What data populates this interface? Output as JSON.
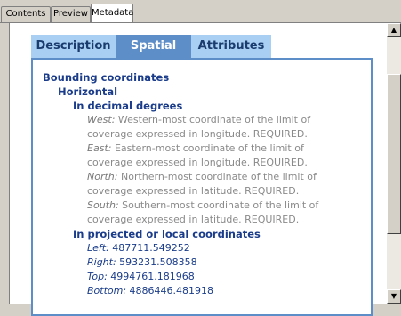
{
  "window_tabs": [
    {
      "label": "Contents",
      "active": false
    },
    {
      "label": "Preview",
      "active": false
    },
    {
      "label": "Metadata",
      "active": true
    }
  ],
  "metadata_tabs": [
    {
      "label": "Description",
      "active": false
    },
    {
      "label": "Spatial",
      "active": true
    },
    {
      "label": "Attributes",
      "active": false
    }
  ],
  "content": {
    "bounding_title": "Bounding coordinates",
    "horizontal": "Horizontal",
    "decimal_title": "In decimal degrees",
    "decimal": [
      {
        "key": "West:",
        "line1": " Western-most coordinate of the limit of",
        "line2": "coverage expressed in longitude. REQUIRED."
      },
      {
        "key": "East:",
        "line1": " Eastern-most coordinate of the limit of",
        "line2": "coverage expressed in longitude. REQUIRED."
      },
      {
        "key": "North:",
        "line1": " Northern-most coordinate of the limit of",
        "line2": "coverage expressed in latitude. REQUIRED."
      },
      {
        "key": "South:",
        "line1": " Southern-most coordinate of the limit of",
        "line2": "coverage expressed in latitude. REQUIRED."
      }
    ],
    "projected_title": "In projected or local coordinates",
    "projected": [
      {
        "key": "Left:",
        "value": " 487711.549252"
      },
      {
        "key": "Right:",
        "value": " 593231.508358"
      },
      {
        "key": "Top:",
        "value": " 4994761.181968"
      },
      {
        "key": "Bottom:",
        "value": " 4886446.481918"
      }
    ]
  },
  "colors": {
    "tab_inactive": "#a9cff2",
    "tab_active": "#5e8ec8",
    "heading_text": "#1a3c8a",
    "definition_text": "#8a8a8a"
  },
  "icons": {
    "scroll_up": "up-arrow-icon",
    "scroll_down": "down-arrow-icon"
  }
}
